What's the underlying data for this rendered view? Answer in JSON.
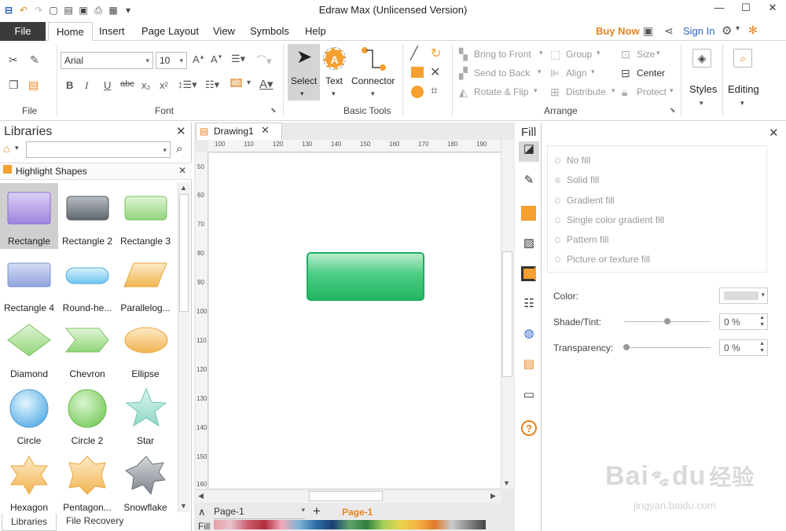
{
  "app": {
    "title": "Edraw Max (Unlicensed Version)"
  },
  "menu": {
    "file": "File",
    "tabs": [
      "Home",
      "Insert",
      "Page Layout",
      "View",
      "Symbols",
      "Help"
    ],
    "buy_now": "Buy Now",
    "sign_in": "Sign In"
  },
  "ribbon": {
    "font_name": "Arial",
    "font_size": "10",
    "groups": {
      "file": "File",
      "font": "Font",
      "basic_tools": "Basic Tools",
      "arrange": "Arrange"
    },
    "tools": {
      "select": "Select",
      "text": "Text",
      "connector": "Connector"
    },
    "arrange": {
      "bring_to_front": "Bring to Front",
      "send_to_back": "Send to Back",
      "rotate_flip": "Rotate & Flip",
      "group": "Group",
      "align": "Align",
      "distribute": "Distribute",
      "size": "Size",
      "center": "Center",
      "protect": "Protect"
    },
    "styles": "Styles",
    "editing": "Editing"
  },
  "libraries": {
    "title": "Libraries",
    "search_placeholder": "",
    "section": "Highlight Shapes",
    "shapes": [
      {
        "label": "Rectangle"
      },
      {
        "label": "Rectangle 2"
      },
      {
        "label": "Rectangle 3"
      },
      {
        "label": "Rectangle 4"
      },
      {
        "label": "Round-he..."
      },
      {
        "label": "Parallelog..."
      },
      {
        "label": "Diamond"
      },
      {
        "label": "Chevron"
      },
      {
        "label": "Ellipse"
      },
      {
        "label": "Circle"
      },
      {
        "label": "Circle 2"
      },
      {
        "label": "Star"
      },
      {
        "label": "Hexagon"
      },
      {
        "label": "Pentagon..."
      },
      {
        "label": "Snowflake"
      }
    ],
    "bottom_tabs": [
      "Libraries",
      "File Recovery"
    ]
  },
  "document": {
    "tab": "Drawing1",
    "hruler": [
      "100",
      "110",
      "120",
      "130",
      "140",
      "150",
      "160",
      "170",
      "180",
      "190"
    ],
    "vruler": [
      "50",
      "60",
      "70",
      "80",
      "90",
      "100",
      "110",
      "120",
      "130",
      "140",
      "150",
      "160"
    ],
    "page_select": "Page-1",
    "page_tab": "Page-1",
    "fill_label": "Fill"
  },
  "fill_panel": {
    "title": "Fill",
    "options": [
      "No fill",
      "Solid fill",
      "Gradient fill",
      "Single color gradient fill",
      "Pattern fill",
      "Picture or texture fill"
    ],
    "selected_option": "Solid fill",
    "color_label": "Color:",
    "shade_label": "Shade/Tint:",
    "shade_value": "0 %",
    "transparency_label": "Transparency:",
    "transparency_value": "0 %"
  },
  "watermark": {
    "text1": "Bai",
    "text2": "du",
    "text3": "经验",
    "url": "jingyan.baidu.com"
  },
  "colors": {
    "accent_orange": "#e8821e",
    "link_blue": "#2a62c9",
    "shape_green": "#2db86c"
  }
}
